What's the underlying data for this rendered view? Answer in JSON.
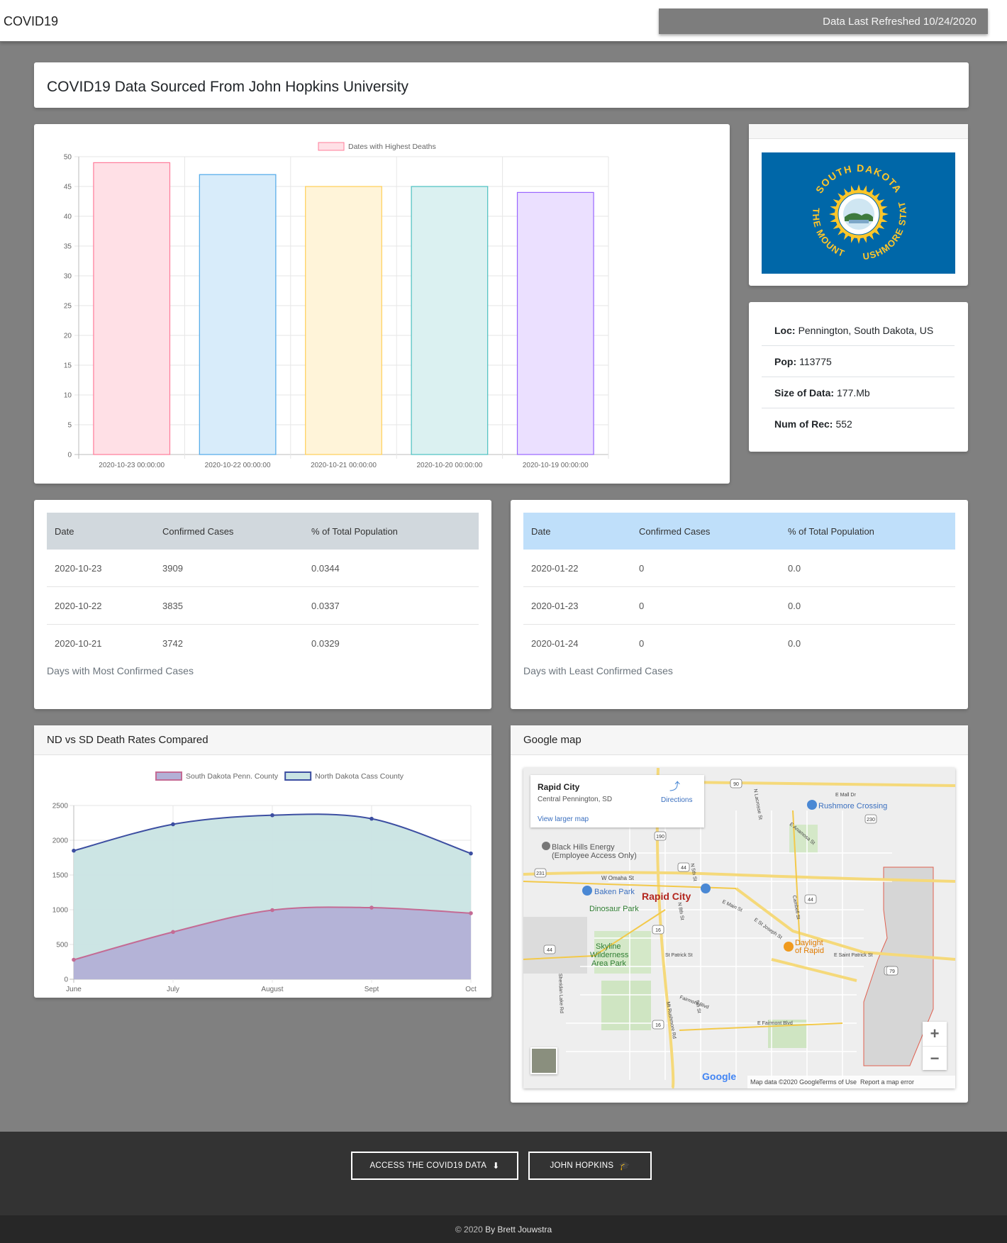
{
  "navbar": {
    "brand": "COVID19",
    "refresh": "Data Last Refreshed 10/24/2020"
  },
  "title": "COVID19 Data Sourced From John Hopkins University",
  "bar_chart": {
    "legend": "Dates with Highest Deaths",
    "colors": {
      "fills": [
        "#ffe0e6",
        "#d8ecfa",
        "#fff4d9",
        "#dbf1f1",
        "#ebe0ff"
      ],
      "strokes": [
        "#ff7c9a",
        "#4fa8e8",
        "#ffce56",
        "#4bc0c0",
        "#9966ff"
      ]
    }
  },
  "info": {
    "loc_label": "Loc:",
    "loc": "Pennington, South Dakota, US",
    "pop_label": "Pop:",
    "pop": "113775",
    "size_label": "Size of Data:",
    "size": "177.Mb",
    "rec_label": "Num of Rec:",
    "rec": "552"
  },
  "flag": {
    "top": "SOUTH DAKOTA",
    "left": "THE MOUNT",
    "right": "RUSHMORE STATE",
    "color": "#0067a8"
  },
  "most_table": {
    "headers": [
      "Date",
      "Confirmed Cases",
      "% of Total Population"
    ],
    "rows": [
      [
        "2020-10-23",
        "3909",
        "0.0344"
      ],
      [
        "2020-10-22",
        "3835",
        "0.0337"
      ],
      [
        "2020-10-21",
        "3742",
        "0.0329"
      ]
    ],
    "caption": "Days with Most Confirmed Cases"
  },
  "least_table": {
    "headers": [
      "Date",
      "Confirmed Cases",
      "% of Total Population"
    ],
    "rows": [
      [
        "2020-01-22",
        "0",
        "0.0"
      ],
      [
        "2020-01-23",
        "0",
        "0.0"
      ],
      [
        "2020-01-24",
        "0",
        "0.0"
      ]
    ],
    "caption": "Days with Least Confirmed Cases"
  },
  "line_card": {
    "header": "ND vs SD Death Rates Compared"
  },
  "map": {
    "header": "Google map",
    "place": "Rapid City",
    "sub": "Central Pennington, SD",
    "directions": "Directions",
    "larger": "View larger map",
    "city": "Rapid City",
    "labels": {
      "black_hills": "Black Hills Energy",
      "black_hills_2": "(Employee Access Only)",
      "baken": "Baken Park",
      "dinosaur": "Dinosaur Park",
      "rushmore": "Rushmore Crossing",
      "skyline": "Skyline",
      "skyline_2": "Wilderness",
      "skyline_3": "Area Park",
      "daylight": "Daylight",
      "daylight_2": "of Rapid",
      "omaha": "W Omaha St",
      "mall": "E Mall Dr",
      "fairmont": "E Fairmont Blvd",
      "fairmont_blvd": "Fairmont Blvd",
      "st_patrick": "St Patrick St",
      "e_st_patrick": "E Saint Patrick St",
      "main": "E Main St",
      "st_joseph": "E St Joseph St",
      "anamosa": "E Anamosa St",
      "lacrosse": "N Lacrosse St",
      "cambell": "Cambell St",
      "sheridan": "Sheridan Lake Rd",
      "n5th": "N 5th St",
      "fifth": "5th St",
      "n8th": "N 8th St",
      "mt_rushmore": "Mt Rushmore Rd",
      "logo": "Google",
      "mapdata": "Map data ©2020 Google",
      "terms": "Terms of Use",
      "report": "Report a map error",
      "zoom_in": "+",
      "zoom_out": "−",
      "shields": [
        "90",
        "190",
        "231",
        "230",
        "44",
        "44",
        "16",
        "16",
        "16",
        "79",
        "44"
      ]
    }
  },
  "footer": {
    "btn1": "ACCESS THE COVID19 DATA",
    "btn2": "JOHN HOPKINS",
    "copyright": "© 2020",
    "author": "By Brett Jouwstra"
  },
  "chart_data": [
    {
      "type": "bar",
      "categories": [
        "2020-10-23 00:00:00",
        "2020-10-22 00:00:00",
        "2020-10-21 00:00:00",
        "2020-10-20 00:00:00",
        "2020-10-19 00:00:00"
      ],
      "series": [
        {
          "name": "Dates with Highest Deaths",
          "values": [
            49,
            47,
            45,
            45,
            44
          ]
        }
      ],
      "ylim": [
        0,
        50
      ],
      "yticks": [
        0,
        5,
        10,
        15,
        20,
        25,
        30,
        35,
        40,
        45,
        50
      ],
      "legend": "top",
      "grid": true
    },
    {
      "type": "area",
      "categories": [
        "June",
        "July",
        "August",
        "Sept",
        "Oct"
      ],
      "series": [
        {
          "name": "South Dakota Penn. County",
          "values": [
            280,
            680,
            995,
            1030,
            950
          ],
          "color": "#c46b94",
          "fill": "#b2b0d6"
        },
        {
          "name": "North Dakota Cass County",
          "values": [
            1850,
            2230,
            2360,
            2310,
            1810
          ],
          "color": "#3c4ea1",
          "fill": "#c9e4e3"
        }
      ],
      "ylim": [
        0,
        2500
      ],
      "yticks": [
        0,
        500,
        1000,
        1500,
        2000,
        2500
      ],
      "legend": "top",
      "grid": true
    }
  ]
}
